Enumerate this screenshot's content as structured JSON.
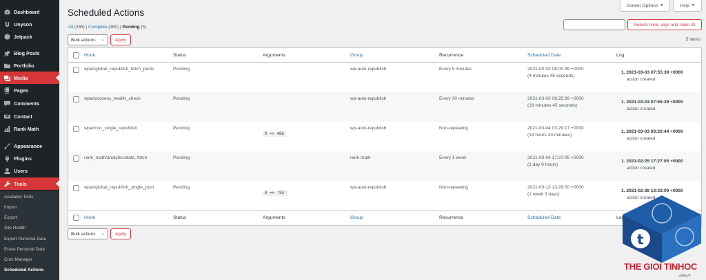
{
  "sidebar": {
    "items": [
      {
        "label": "Dashboard",
        "icon": "dashboard-icon"
      },
      {
        "label": "Unyson",
        "icon": "unyson-icon"
      },
      {
        "label": "Jetpack",
        "icon": "jetpack-icon"
      },
      {
        "label": "Blog Posts",
        "icon": "pin-icon"
      },
      {
        "label": "Portfolio",
        "icon": "folder-icon"
      },
      {
        "label": "Media",
        "icon": "media-icon"
      },
      {
        "label": "Pages",
        "icon": "pages-icon"
      },
      {
        "label": "Comments",
        "icon": "comments-icon"
      },
      {
        "label": "Contact",
        "icon": "mail-icon"
      },
      {
        "label": "Rank Math",
        "icon": "chart-icon"
      },
      {
        "label": "Appearance",
        "icon": "brush-icon"
      },
      {
        "label": "Plugins",
        "icon": "plugin-icon"
      },
      {
        "label": "Users",
        "icon": "users-icon"
      },
      {
        "label": "Tools",
        "icon": "wrench-icon"
      }
    ],
    "submenu": [
      "Available Tools",
      "Import",
      "Export",
      "Site Health",
      "Export Personal Data",
      "Erase Personal Data",
      "Cron Manager",
      "Scheduled Actions"
    ]
  },
  "top": {
    "screen_options": "Screen Options",
    "help": "Help"
  },
  "page_title": "Scheduled Actions",
  "filters": {
    "all": "All",
    "all_count": "(365)",
    "complete": "Complete",
    "complete_count": "(360)",
    "pending": "Pending",
    "pending_count": "(5)",
    "sep": "|"
  },
  "search": {
    "value": "",
    "button": "Search hook, args and claim ID"
  },
  "bulk": {
    "label": "Bulk actions",
    "apply": "Apply"
  },
  "items_count": "5 items",
  "columns": [
    "Hook",
    "Status",
    "Arguments",
    "Group",
    "Recurrence",
    "Scheduled Date",
    "Log"
  ],
  "rows": [
    {
      "hook": "wpar/global_republish_fetch_posts",
      "status": "Pending",
      "args": "",
      "group": "wp-auto-republish",
      "recurrence": "Every 5 minutes",
      "date": "2021-03-03 08:00:39 +0000",
      "date_rel": "(4 minutes 45 seconds)",
      "log_date": "1. 2021-03-03 07:55:39 +0000",
      "log_msg": "action created"
    },
    {
      "hook": "wpar/process_health_check",
      "status": "Pending",
      "args": "",
      "group": "wp-auto-republish",
      "recurrence": "Every 30 minutes",
      "date": "2021-03-03 08:25:39 +0000",
      "date_rel": "(29 minutes 45 seconds)",
      "log_date": "1. 2021-03-03 07:55:39 +0000",
      "log_msg": "action created"
    },
    {
      "hook": "wpar/run_single_republish",
      "status": "Pending",
      "args": "0 => 486",
      "group": "wp-auto-republish",
      "recurrence": "Non-repeating",
      "date": "2021-03-04 03:29:17 +0000",
      "date_rel": "(19 hours 33 minutes)",
      "log_date": "1. 2021-03-03 03:20:44 +0000",
      "log_msg": "action created"
    },
    {
      "hook": "rank_math/analytics/data_fetch",
      "status": "Pending",
      "args": "",
      "group": "rank-math",
      "recurrence": "Every 1 week",
      "date": "2021-03-04 17:27:05 +0000",
      "date_rel": "(1 day 9 hours)",
      "log_date": "1. 2021-02-25 17:27:05 +0000",
      "log_msg": "action created"
    },
    {
      "hook": "wpar/global_republish_single_post",
      "status": "Pending",
      "args": "0 => '85'",
      "group": "wp-auto-republish",
      "recurrence": "Non-repeating",
      "date": "2021-03-13 13:29:00 +0000",
      "date_rel": "(1 week 3 days)",
      "log_date": "1. 2021-02-28 13:33:09 +0000",
      "log_msg": "action created"
    }
  ],
  "watermark": {
    "brand_a": "THE GIOI",
    "brand_b": "TINHOC",
    "domain": ".com.vn",
    "icon": "watermark-cube-icon"
  }
}
